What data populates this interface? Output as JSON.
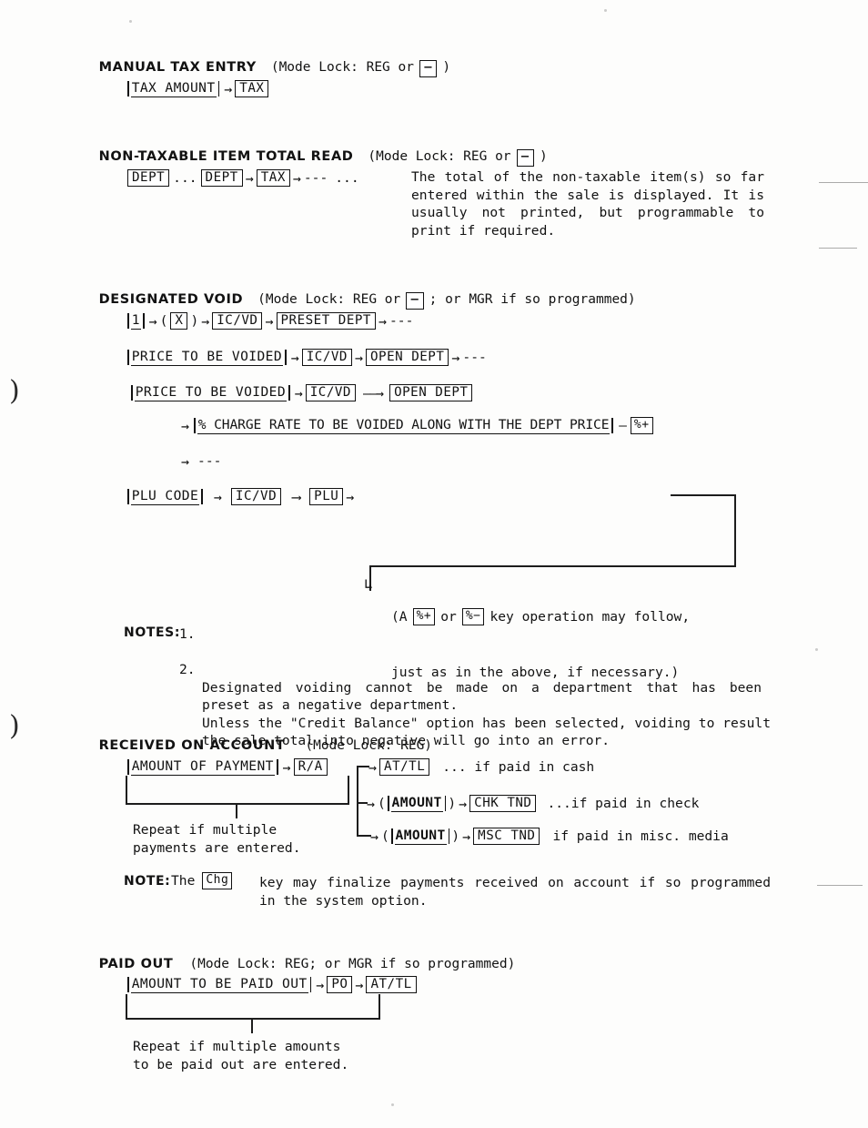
{
  "document": {
    "type": "cash-register-operation-manual-page",
    "sections": [
      {
        "id": "manual-tax-entry",
        "title": "MANUAL TAX ENTRY",
        "mode_prefix": "(Mode Lock: REG or",
        "mode_key": "−",
        "mode_suffix": ")",
        "flow": {
          "entry": "TAX AMOUNT",
          "arrow": "→",
          "key": "TAX"
        }
      },
      {
        "id": "non-taxable-item-total-read",
        "title": "NON-TAXABLE ITEM TOTAL READ",
        "mode_prefix": "(Mode Lock: REG or",
        "mode_key": "−",
        "mode_suffix": ")",
        "flow": {
          "key1": "DEPT",
          "ellipsis1": "...",
          "key2": "DEPT",
          "arrow1": "→",
          "key3": "TAX",
          "arrow2": "→",
          "dashes": "---",
          "ellipsis2": "..."
        },
        "description": "The total of the non-taxable item(s) so far entered within the sale is displayed.  It is usually not printed, but programmable to print if required."
      },
      {
        "id": "designated-void",
        "title": "DESIGNATED VOID",
        "mode_prefix": "(Mode Lock: REG or",
        "mode_key": "−",
        "mode_suffix": "; or MGR if so programmed)",
        "rows": [
          {
            "id": "void-preset-dept",
            "entry": "1",
            "paren_open": "(",
            "key_x": "X",
            "paren_close": ")",
            "key_icvd": "IC/VD",
            "key_dept": "PRESET DEPT",
            "tail": "---"
          },
          {
            "id": "void-open-dept",
            "entry": "PRICE TO BE VOIDED",
            "key_icvd": "IC/VD",
            "key_dept": "OPEN DEPT",
            "tail": "---"
          },
          {
            "id": "void-open-dept-with-percent",
            "entry": "PRICE TO BE VOIDED",
            "key_icvd": "IC/VD",
            "key_dept": "OPEN DEPT",
            "sub_entry": "% CHARGE RATE TO BE VOIDED ALONG WITH THE DEPT PRICE",
            "sub_dash": "—",
            "sub_key": "%+",
            "tail": "---"
          },
          {
            "id": "void-plu",
            "entry": "PLU CODE",
            "key_icvd": "IC/VD",
            "key_plu": "PLU"
          }
        ],
        "callout": {
          "line1_pre": "(A",
          "key_plus": "%+",
          "line1_mid": "or",
          "key_minus": "%−",
          "line1_post": "key operation may follow,",
          "line2": "just as in the above, if necessary.)"
        },
        "notes_label": "NOTES:",
        "notes": [
          {
            "num": "1.",
            "text": "Designated voiding cannot be made on a department that has been preset as a negative department."
          },
          {
            "num": "2.",
            "text": "Unless the \"Credit Balance\" option has been selected, voiding to result the sale total into negative will go into an error."
          }
        ]
      },
      {
        "id": "received-on-account",
        "title": "RECEIVED ON ACCOUNT",
        "mode_prefix": "(Mode Lock: REG)",
        "flow": {
          "entry": "AMOUNT OF PAYMENT",
          "key_ra": "R/A"
        },
        "branches": [
          {
            "id": "branch-cash",
            "paren": false,
            "key": "AT/TL",
            "note": "... if paid in cash"
          },
          {
            "id": "branch-check",
            "paren": true,
            "entry": "AMOUNT",
            "key": "CHK TND",
            "note": "...if paid in check"
          },
          {
            "id": "branch-misc",
            "paren": true,
            "entry": "AMOUNT",
            "key": "MSC TND",
            "note": "if paid in misc. media"
          }
        ],
        "repeat_note": "Repeat if multiple\npayments are entered.",
        "note_label": "NOTE:",
        "note_pre": "The",
        "note_key": "Chg",
        "note_post": "key may finalize payments received on account if so programmed in the system option."
      },
      {
        "id": "paid-out",
        "title": "PAID OUT",
        "mode_prefix": "(Mode Lock: REG; or MGR if so programmed)",
        "flow": {
          "entry": "AMOUNT TO BE PAID OUT",
          "key_po": "PO",
          "key_attl": "AT/TL"
        },
        "repeat_note": "Repeat if multiple amounts\nto be paid out are entered."
      }
    ]
  },
  "glyphs": {
    "arrow": "→",
    "long_arrow": "⟶",
    "dashes": "---",
    "ellipsis": "...",
    "margin_mark": ")"
  }
}
